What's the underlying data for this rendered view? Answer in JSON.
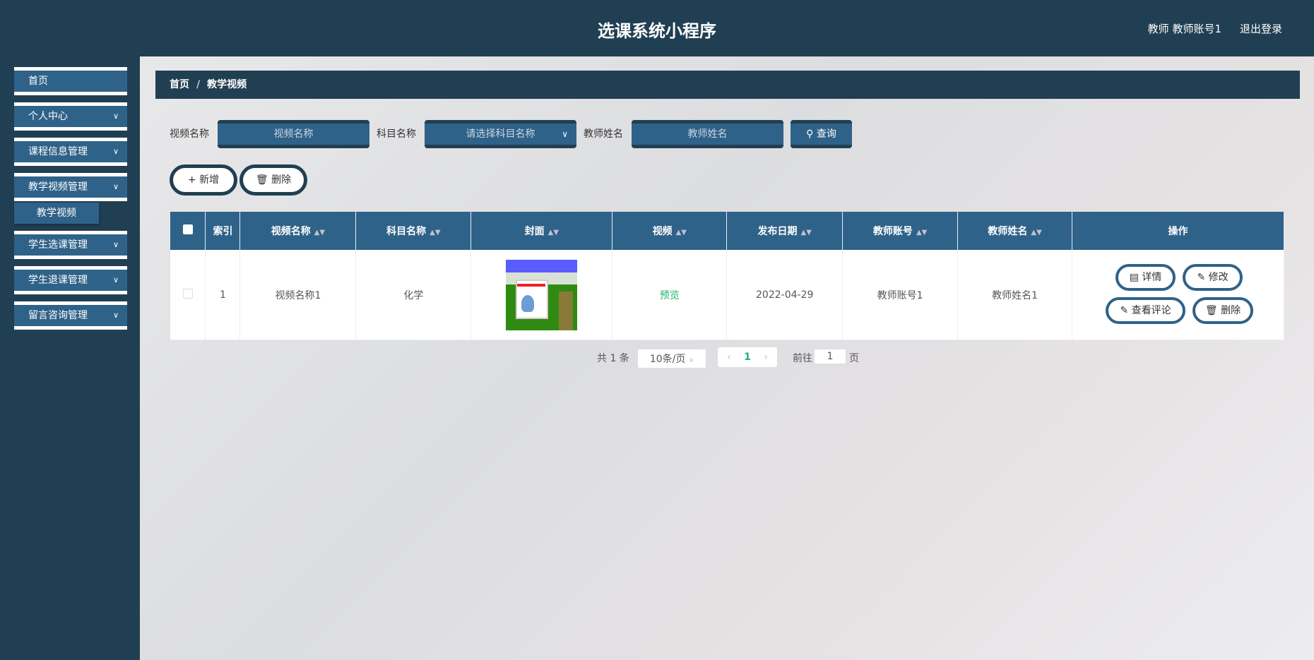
{
  "header": {
    "title": "选课系统小程序",
    "user_role": "教师",
    "user_name": "教师账号1",
    "logout": "退出登录"
  },
  "sidebar": {
    "items": [
      {
        "label": "首页"
      },
      {
        "label": "个人中心"
      },
      {
        "label": "课程信息管理"
      },
      {
        "label": "教学视频管理",
        "submenu": [
          {
            "label": "教学视频"
          }
        ]
      },
      {
        "label": "学生选课管理"
      },
      {
        "label": "学生退课管理"
      },
      {
        "label": "留言咨询管理"
      }
    ]
  },
  "breadcrumb": {
    "home": "首页",
    "separator": "/",
    "current": "教学视频"
  },
  "search": {
    "video_name_label": "视频名称",
    "video_name_placeholder": "视频名称",
    "subject_label": "科目名称",
    "subject_placeholder": "请选择科目名称",
    "teacher_label": "教师姓名",
    "teacher_placeholder": "教师姓名",
    "query_label": "查询"
  },
  "actions": {
    "add_label": "新增",
    "delete_label": "删除"
  },
  "table": {
    "columns": [
      "索引",
      "视频名称",
      "科目名称",
      "封面",
      "视频",
      "发布日期",
      "教师账号",
      "教师姓名",
      "操作"
    ],
    "rows": [
      {
        "index": "1",
        "video_name": "视频名称1",
        "subject": "化学",
        "video": "预览",
        "date": "2022-04-29",
        "teacher_account": "教师账号1",
        "teacher_name": "教师姓名1"
      }
    ],
    "row_actions": {
      "detail": "详情",
      "edit": "修改",
      "comments": "查看评论",
      "delete": "删除"
    }
  },
  "pagination": {
    "total": "共 1 条",
    "page_size": "10条/页",
    "current_page": "1",
    "goto_label": "前往",
    "goto_value": "1",
    "page_suffix": "页"
  },
  "colors": {
    "header": "#213f52",
    "primary": "#2f6289",
    "preview": "#1fb36e"
  }
}
